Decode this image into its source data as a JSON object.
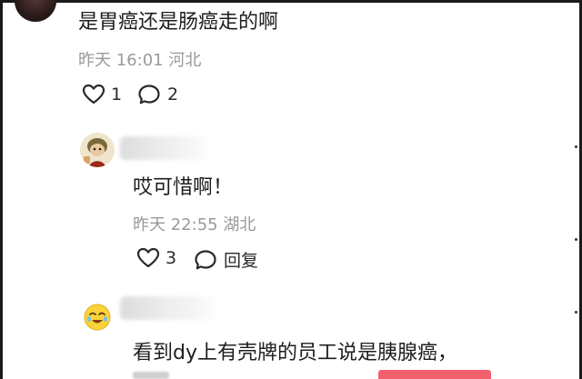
{
  "comment1": {
    "text": "是胃癌还是肠癌走的啊",
    "meta": "昨天 16:01 河北",
    "like_count": "1",
    "reply_count": "2"
  },
  "reply1": {
    "text": "哎可惜啊！",
    "meta": "昨天 22:55 湖北",
    "like_count": "3",
    "reply_label": "回复"
  },
  "reply2": {
    "text": "看到dy上有壳牌的员工说是胰腺癌，"
  },
  "colors": {
    "meta_gray": "#9a9a9a",
    "accent_pink": "#f2606e"
  }
}
